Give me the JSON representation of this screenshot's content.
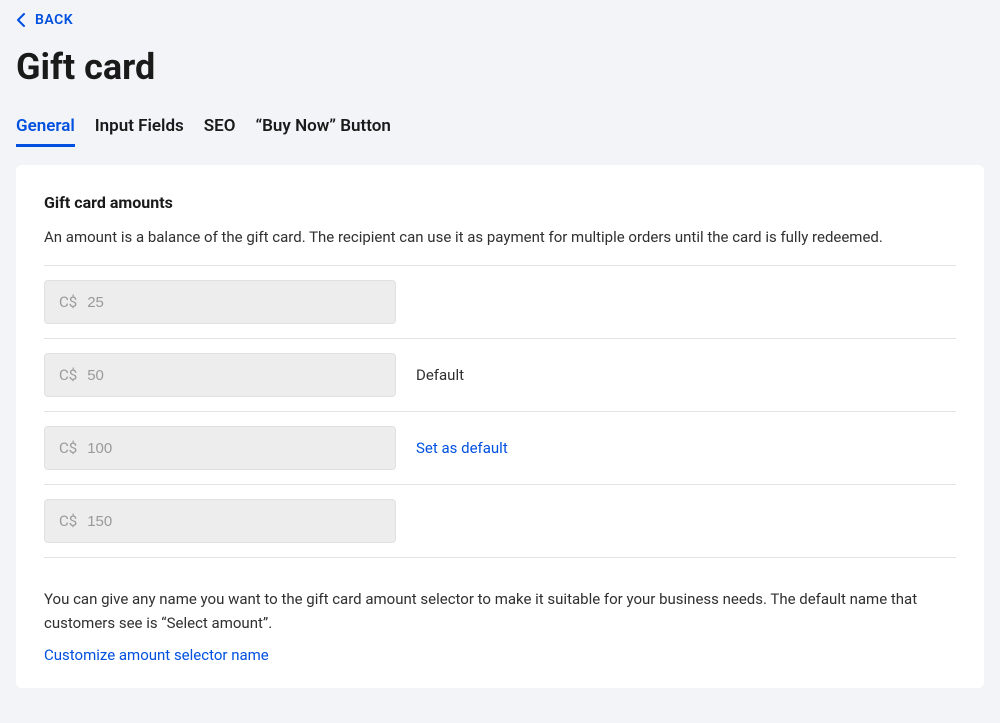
{
  "nav": {
    "back_label": "BACK"
  },
  "page_title": "Gift card",
  "tabs": [
    {
      "label": "General",
      "active": true
    },
    {
      "label": "Input Fields",
      "active": false
    },
    {
      "label": "SEO",
      "active": false
    },
    {
      "label": "“Buy Now” Button",
      "active": false
    }
  ],
  "section": {
    "title": "Gift card amounts",
    "description": "An amount is a balance of the gift card. The recipient can use it as payment for multiple orders until the card is fully redeemed.",
    "currency_prefix": "C$",
    "amounts": [
      {
        "value": "25",
        "badge": "",
        "action": ""
      },
      {
        "value": "50",
        "badge": "Default",
        "action": ""
      },
      {
        "value": "100",
        "badge": "",
        "action": "Set as default"
      },
      {
        "value": "150",
        "badge": "",
        "action": ""
      }
    ],
    "footer_text": "You can give any name you want to the gift card amount selector to make it suitable for your business needs. The default name that customers see is “Select amount”.",
    "customize_link": "Customize amount selector name"
  }
}
